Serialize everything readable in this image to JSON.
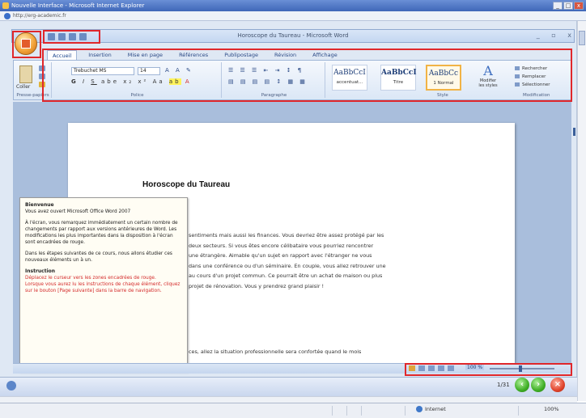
{
  "browser": {
    "title": "Nouvelle Interface - Microsoft Internet Explorer",
    "address": "http://erg-academic.fr"
  },
  "word": {
    "title": "Horoscope du Taureau - Microsoft Word",
    "tabs": [
      "Accueil",
      "Insertion",
      "Mise en page",
      "Références",
      "Publipostage",
      "Révision",
      "Affichage"
    ],
    "clipboard": {
      "paste": "Coller",
      "label": "Presse-papiers"
    },
    "font": {
      "name": "Trebuchet MS",
      "size": "14",
      "label": "Police"
    },
    "paragraph": {
      "label": "Paragraphe"
    },
    "styles": {
      "label": "Style",
      "items": [
        {
          "sample": "AaBbCcI",
          "name": "accentuat..."
        },
        {
          "sample": "AaBbCcI",
          "name": "Titre"
        },
        {
          "sample": "AaBbCc",
          "name": "1 Normal"
        }
      ],
      "change": "Modifier les styles"
    },
    "editing": {
      "label": "Modification",
      "items": [
        "Rechercher",
        "Remplacer",
        "Sélectionner"
      ]
    },
    "zoom": "100 %"
  },
  "document": {
    "heading": "Horoscope du Taureau",
    "lines": [
      "sentiments mais aussi les finances. Vous devriez être assez protégé par les",
      "deux secteurs. Si vous êtes encore célibataire vous pourriez rencontrer",
      "une étrangère. Aimable qu'un sujet en rapport avec l'étranger ne vous",
      "dans une conférence ou d'un séminaire. En couple, vous allez retrouver une",
      "au cours d'un projet commun. Ce pourrait être un achat de maison ou plus",
      "projet de rénovation. Vous y prendrez grand plaisir !"
    ],
    "bottom_line": "ces, allez la situation professionnelle sera confortée quand le mois"
  },
  "note": {
    "title": "Bienvenue",
    "intro": "Vous avez ouvert Microsoft Office Word 2007",
    "para1": "À l'écran, vous remarquez immédiatement un certain nombre de changements par rapport aux versions antérieures de Word. Les modifications les plus importantes dans la disposition à l'écran sont encadrées de rouge.",
    "para2": "Dans les étapes suivantes de ce cours, nous allons étudier ces nouveaux éléments un à un.",
    "instruction_title": "Instruction",
    "instruction1": "Déplacez le curseur vers les zones encadrées de rouge.",
    "instruction2": "Lorsque vous aurez lu les instructions de chaque élément, cliquez sur le bouton [Page suivante] dans la barre de navigation."
  },
  "player": {
    "counter": "1/31"
  },
  "ie_status": {
    "zone": "Internet",
    "zoom": "100%"
  },
  "colors": {
    "highlight": "#e0272b",
    "ribbon": "#dbe7f6",
    "note_red": "#d42a2a"
  }
}
